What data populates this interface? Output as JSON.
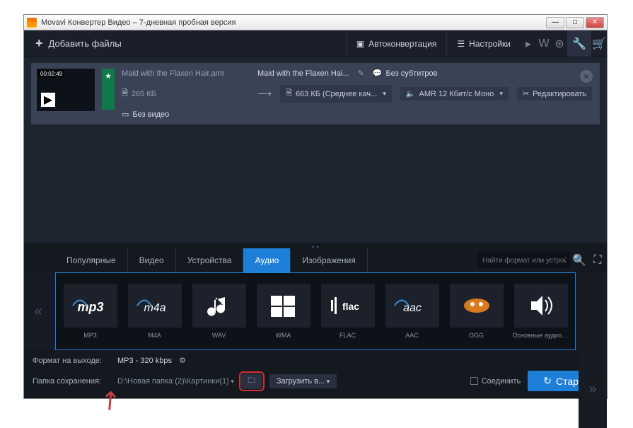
{
  "window": {
    "title": "Movavi Конвертер Видео – 7-дневная пробная версия"
  },
  "toolbar": {
    "add_files": "Добавить файлы",
    "autoconvert": "Автоконвертация",
    "settings": "Настройки"
  },
  "file": {
    "duration": "00:02:49",
    "name": "Maid with the Flaxen Hair.amr",
    "name_short": "Maid with the Flaxen Hai...",
    "size_in": "265 КБ",
    "size_out": "663 КБ (Среднее кач...",
    "subtitles": "Без субтитров",
    "audio_format": "AMR 12 Кбит/с Моно",
    "no_video": "Без видео",
    "edit": "Редактировать"
  },
  "tabs": {
    "popular": "Популярные",
    "video": "Видео",
    "devices": "Устройства",
    "audio": "Аудио",
    "images": "Изображения"
  },
  "search": {
    "placeholder": "Найти формат или устрой..."
  },
  "formats": {
    "mp3": "MP3",
    "m4a": "M4A",
    "wav": "WAV",
    "wma": "WMA",
    "flac": "FLAC",
    "aac": "AAC",
    "ogg": "OGG",
    "basic": "Основные аудиоф..."
  },
  "output": {
    "format_label": "Формат на выходе:",
    "format_value": "MP3 - 320 kbps",
    "folder_label": "Папка сохранения:",
    "folder_value": "D:\\Новая папка (2)\\Картинки(1)",
    "upload": "Загрузить в...",
    "join": "Соединить",
    "start": "Старт"
  }
}
